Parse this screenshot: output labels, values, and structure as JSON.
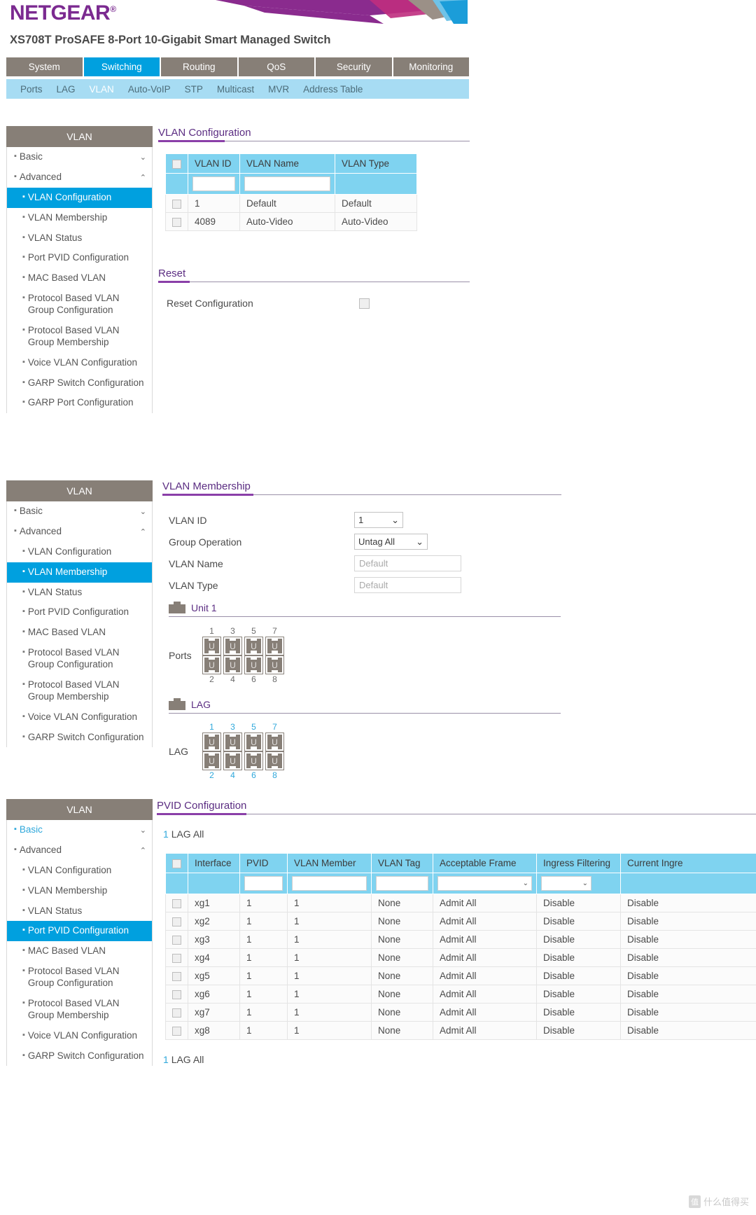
{
  "header": {
    "brand": "NETGEAR",
    "registered_mark": "®",
    "model_title": "XS708T ProSAFE 8-Port 10-Gigabit Smart Managed Switch"
  },
  "top_nav": [
    {
      "label": "System",
      "active": false
    },
    {
      "label": "Switching",
      "active": true
    },
    {
      "label": "Routing",
      "active": false
    },
    {
      "label": "QoS",
      "active": false
    },
    {
      "label": "Security",
      "active": false
    },
    {
      "label": "Monitoring",
      "active": false
    }
  ],
  "sub_nav": [
    {
      "label": "Ports",
      "active": false
    },
    {
      "label": "LAG",
      "active": false
    },
    {
      "label": "VLAN",
      "active": true
    },
    {
      "label": "Auto-VoIP",
      "active": false
    },
    {
      "label": "STP",
      "active": false
    },
    {
      "label": "Multicast",
      "active": false
    },
    {
      "label": "MVR",
      "active": false
    },
    {
      "label": "Address Table",
      "active": false
    }
  ],
  "sidebar": {
    "title": "VLAN",
    "basic_label": "Basic",
    "advanced_label": "Advanced",
    "items": [
      "VLAN Configuration",
      "VLAN Membership",
      "VLAN Status",
      "Port PVID Configuration",
      "MAC Based VLAN",
      "Protocol Based VLAN Group Configuration",
      "Protocol Based VLAN Group Membership",
      "Voice VLAN Configuration",
      "GARP Switch Configuration",
      "GARP Port Configuration"
    ],
    "active_panel_1": "VLAN Configuration",
    "active_panel_2": "VLAN Membership",
    "active_panel_3": "Port PVID Configuration"
  },
  "vlan_configuration": {
    "section_title": "VLAN Configuration",
    "columns": [
      "VLAN ID",
      "VLAN Name",
      "VLAN Type"
    ],
    "filter_row": {
      "vlan_id": "",
      "vlan_name": "",
      "vlan_type": ""
    },
    "rows": [
      {
        "vlan_id": "1",
        "vlan_name": "Default",
        "vlan_type": "Default"
      },
      {
        "vlan_id": "4089",
        "vlan_name": "Auto-Video",
        "vlan_type": "Auto-Video"
      }
    ]
  },
  "reset": {
    "section_title": "Reset",
    "label": "Reset Configuration"
  },
  "vlan_membership": {
    "section_title": "VLAN Membership",
    "fields": [
      {
        "label": "VLAN ID",
        "value": "1",
        "type": "select"
      },
      {
        "label": "Group Operation",
        "value": "Untag All",
        "type": "select"
      },
      {
        "label": "VLAN Name",
        "value": "Default",
        "type": "input-placeholder"
      },
      {
        "label": "VLAN Type",
        "value": "Default",
        "type": "input-placeholder"
      }
    ],
    "unit": {
      "label": "Unit 1",
      "ports_caption": "Ports",
      "top_numbers": [
        "1",
        "3",
        "5",
        "7"
      ],
      "bottom_numbers": [
        "2",
        "4",
        "6",
        "8"
      ],
      "state": "U"
    },
    "lag": {
      "label": "LAG",
      "caption": "LAG",
      "top_numbers": [
        "1",
        "3",
        "5",
        "7"
      ],
      "bottom_numbers": [
        "2",
        "4",
        "6",
        "8"
      ],
      "state": "U"
    }
  },
  "pvid_configuration": {
    "section_title": "PVID Configuration",
    "toggle_top": {
      "num": "1",
      "text": "LAG All"
    },
    "toggle_bottom": {
      "num": "1",
      "text": "LAG All"
    },
    "columns": [
      "Interface",
      "PVID",
      "VLAN Member",
      "VLAN Tag",
      "Acceptable Frame",
      "Ingress Filtering",
      "Current Ingre"
    ],
    "filter_row": {
      "pvid": "",
      "vlan_member": "",
      "vlan_tag": "",
      "acceptable_frame": "",
      "ingress_filtering": ""
    },
    "rows": [
      {
        "interface": "xg1",
        "pvid": "1",
        "vlan_member": "1",
        "vlan_tag": "None",
        "acceptable_frame": "Admit All",
        "ingress_filtering": "Disable",
        "current_ingress": "Disable"
      },
      {
        "interface": "xg2",
        "pvid": "1",
        "vlan_member": "1",
        "vlan_tag": "None",
        "acceptable_frame": "Admit All",
        "ingress_filtering": "Disable",
        "current_ingress": "Disable"
      },
      {
        "interface": "xg3",
        "pvid": "1",
        "vlan_member": "1",
        "vlan_tag": "None",
        "acceptable_frame": "Admit All",
        "ingress_filtering": "Disable",
        "current_ingress": "Disable"
      },
      {
        "interface": "xg4",
        "pvid": "1",
        "vlan_member": "1",
        "vlan_tag": "None",
        "acceptable_frame": "Admit All",
        "ingress_filtering": "Disable",
        "current_ingress": "Disable"
      },
      {
        "interface": "xg5",
        "pvid": "1",
        "vlan_member": "1",
        "vlan_tag": "None",
        "acceptable_frame": "Admit All",
        "ingress_filtering": "Disable",
        "current_ingress": "Disable"
      },
      {
        "interface": "xg6",
        "pvid": "1",
        "vlan_member": "1",
        "vlan_tag": "None",
        "acceptable_frame": "Admit All",
        "ingress_filtering": "Disable",
        "current_ingress": "Disable"
      },
      {
        "interface": "xg7",
        "pvid": "1",
        "vlan_member": "1",
        "vlan_tag": "None",
        "acceptable_frame": "Admit All",
        "ingress_filtering": "Disable",
        "current_ingress": "Disable"
      },
      {
        "interface": "xg8",
        "pvid": "1",
        "vlan_member": "1",
        "vlan_tag": "None",
        "acceptable_frame": "Admit All",
        "ingress_filtering": "Disable",
        "current_ingress": "Disable"
      }
    ]
  },
  "watermark": {
    "text1": "值",
    "text2": "什么值得买"
  },
  "colors": {
    "brand_purple": "#7b2a90",
    "accent_blue": "#00a0df",
    "subnav_blue": "#a7dcf3",
    "nav_brown": "#877f77",
    "table_header_blue": "#7fd3f0",
    "heading_purple": "#5b2d82"
  }
}
